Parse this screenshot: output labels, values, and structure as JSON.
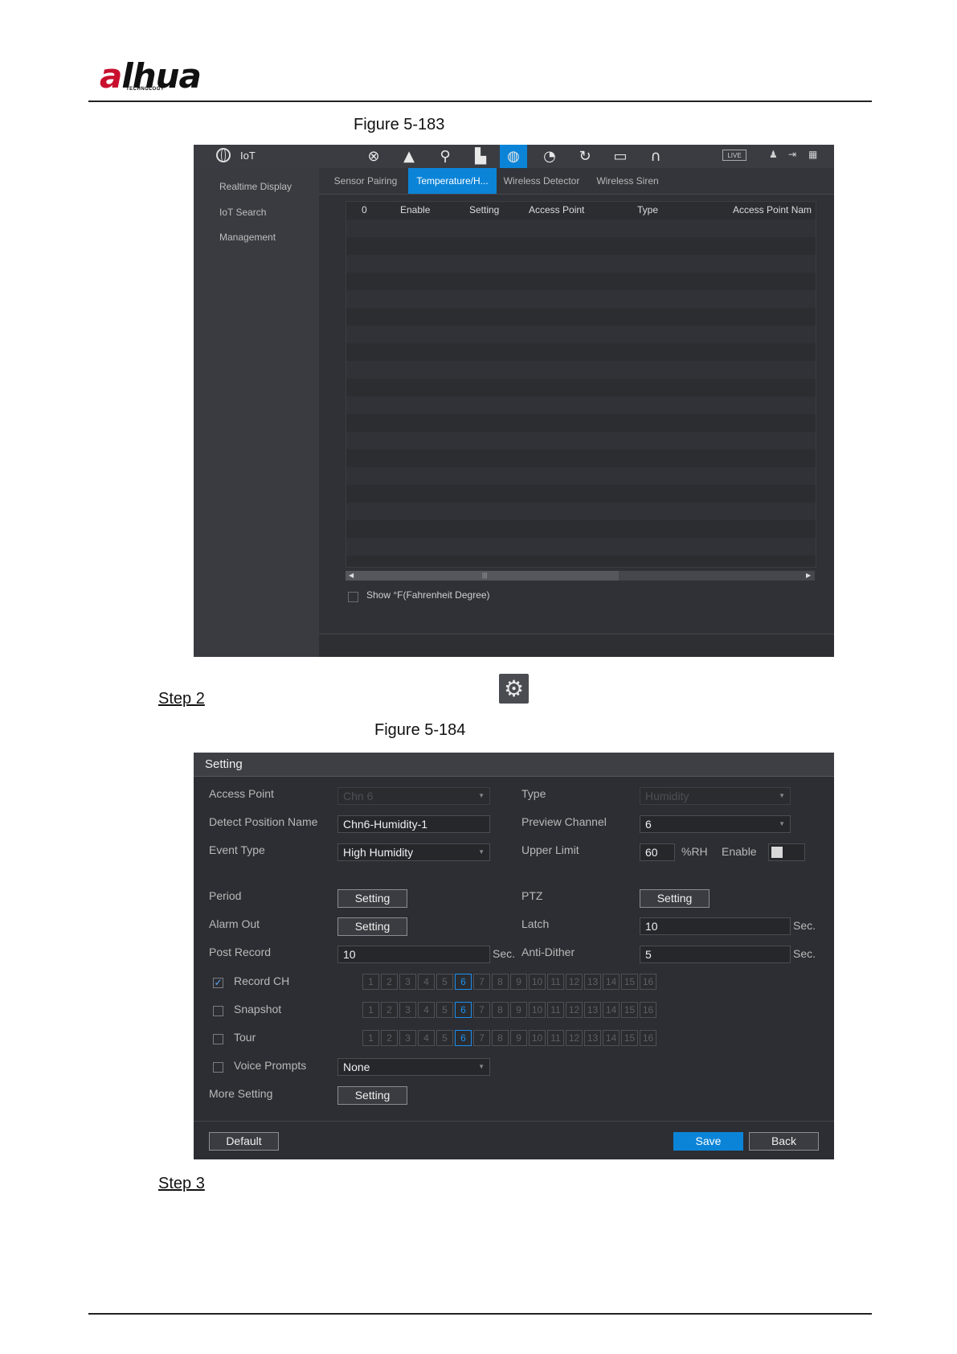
{
  "header": {
    "logo_text": "alhua",
    "logo_sub": "TECHNOLOGY"
  },
  "captions": {
    "fig1": "Figure 5-183",
    "fig2": "Figure 5-184",
    "step2": "Step 2",
    "step3": "Step 3"
  },
  "fig1": {
    "title": "IoT",
    "toolbar_icons": [
      "camera-icon",
      "bell-icon",
      "search-icon",
      "network-icon",
      "globe-icon",
      "gauge-icon",
      "refresh-icon",
      "monitor-icon",
      "headset-icon"
    ],
    "live": "LIVE",
    "sidebar": [
      "Realtime Display",
      "IoT Search",
      "Management"
    ],
    "tabs": [
      "Sensor Pairing",
      "Temperature/H...",
      "Wireless Detector",
      "Wireless Siren"
    ],
    "active_tab": 1,
    "columns": [
      "0",
      "Enable",
      "Setting",
      "Access Point",
      "Type",
      "Access Point Nam"
    ],
    "show_fahrenheit": "Show °F(Fahrenheit Degree)"
  },
  "fig2": {
    "title": "Setting",
    "access_point": {
      "label": "Access Point",
      "value": "Chn 6"
    },
    "type": {
      "label": "Type",
      "value": "Humidity"
    },
    "detect_position": {
      "label": "Detect Position Name",
      "value": "Chn6-Humidity-1"
    },
    "preview_channel": {
      "label": "Preview Channel",
      "value": "6"
    },
    "event_type": {
      "label": "Event Type",
      "value": "High Humidity"
    },
    "upper_limit": {
      "label": "Upper Limit",
      "value": "60",
      "unit": "%RH",
      "enable": "Enable"
    },
    "period": {
      "label": "Period",
      "button": "Setting"
    },
    "ptz": {
      "label": "PTZ",
      "button": "Setting"
    },
    "alarm_out": {
      "label": "Alarm Out",
      "button": "Setting"
    },
    "latch": {
      "label": "Latch",
      "value": "10",
      "unit": "Sec."
    },
    "post_record": {
      "label": "Post Record",
      "value": "10",
      "unit": "Sec."
    },
    "anti_dither": {
      "label": "Anti-Dither",
      "value": "5",
      "unit": "Sec."
    },
    "record_ch": {
      "label": "Record CH",
      "checked": true
    },
    "snapshot": {
      "label": "Snapshot",
      "checked": false
    },
    "tour": {
      "label": "Tour",
      "checked": false
    },
    "channels": [
      "1",
      "2",
      "3",
      "4",
      "5",
      "6",
      "7",
      "8",
      "9",
      "10",
      "11",
      "12",
      "13",
      "14",
      "15",
      "16"
    ],
    "selected_channel": "6",
    "voice_prompts": {
      "label": "Voice Prompts",
      "value": "None",
      "checked": false
    },
    "more_setting": {
      "label": "More Setting",
      "button": "Setting"
    },
    "buttons": {
      "default": "Default",
      "save": "Save",
      "back": "Back"
    }
  }
}
